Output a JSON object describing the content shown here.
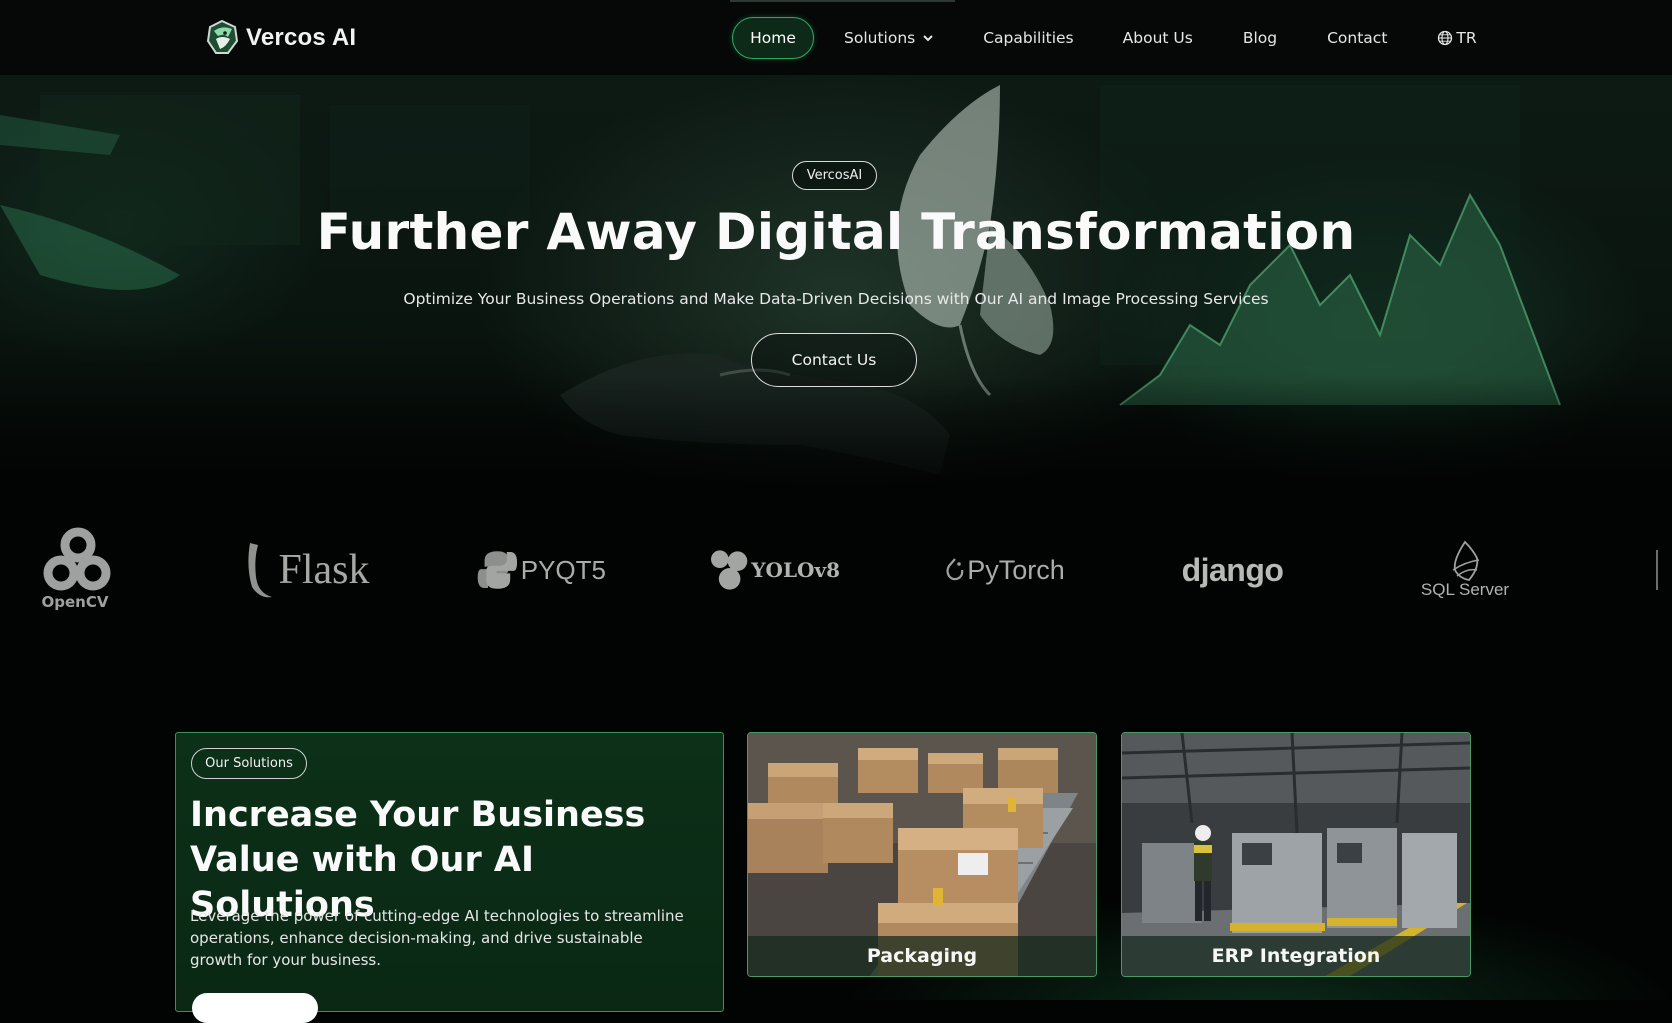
{
  "nav": {
    "brand_name": "Vercos AI",
    "items": [
      {
        "label": "Home",
        "active": true
      },
      {
        "label": "Solutions",
        "has_dropdown": true
      },
      {
        "label": "Capabilities"
      },
      {
        "label": "About Us"
      },
      {
        "label": "Blog"
      },
      {
        "label": "Contact"
      },
      {
        "label": "TR",
        "icon": "globe-icon"
      }
    ]
  },
  "hero": {
    "badge": "VercosAI",
    "title": "Further Away Digital Transformation",
    "subtitle": "Optimize Your Business Operations and Make Data-Driven Decisions with Our AI and Image Processing Services",
    "cta_label": "Contact Us"
  },
  "tech_logos": {
    "items": [
      {
        "name": "OpenCV",
        "icon": "opencv-logo"
      },
      {
        "name": "Flask",
        "icon": "flask-logo"
      },
      {
        "name": "PYQT5",
        "icon": "pyqt5-logo"
      },
      {
        "name": "YOLOv8",
        "icon": "yolov8-logo"
      },
      {
        "name": "PyTorch",
        "icon": "pytorch-logo"
      },
      {
        "name": "django",
        "icon": "django-logo"
      },
      {
        "name": "SQL Server",
        "icon": "sql-server-logo"
      }
    ]
  },
  "solutions": {
    "badge": "Our Solutions",
    "title": "Increase Your Business Value with Our AI Solutions",
    "description": "Leverage the power of cutting-edge AI technologies to streamline operations, enhance decision-making, and drive sustainable growth for your business.",
    "cards": [
      {
        "label": "Packaging"
      },
      {
        "label": "ERP Integration"
      }
    ]
  },
  "colors": {
    "accent_green": "#2fa864",
    "background": "#020403",
    "card_green": "#0c3018"
  }
}
